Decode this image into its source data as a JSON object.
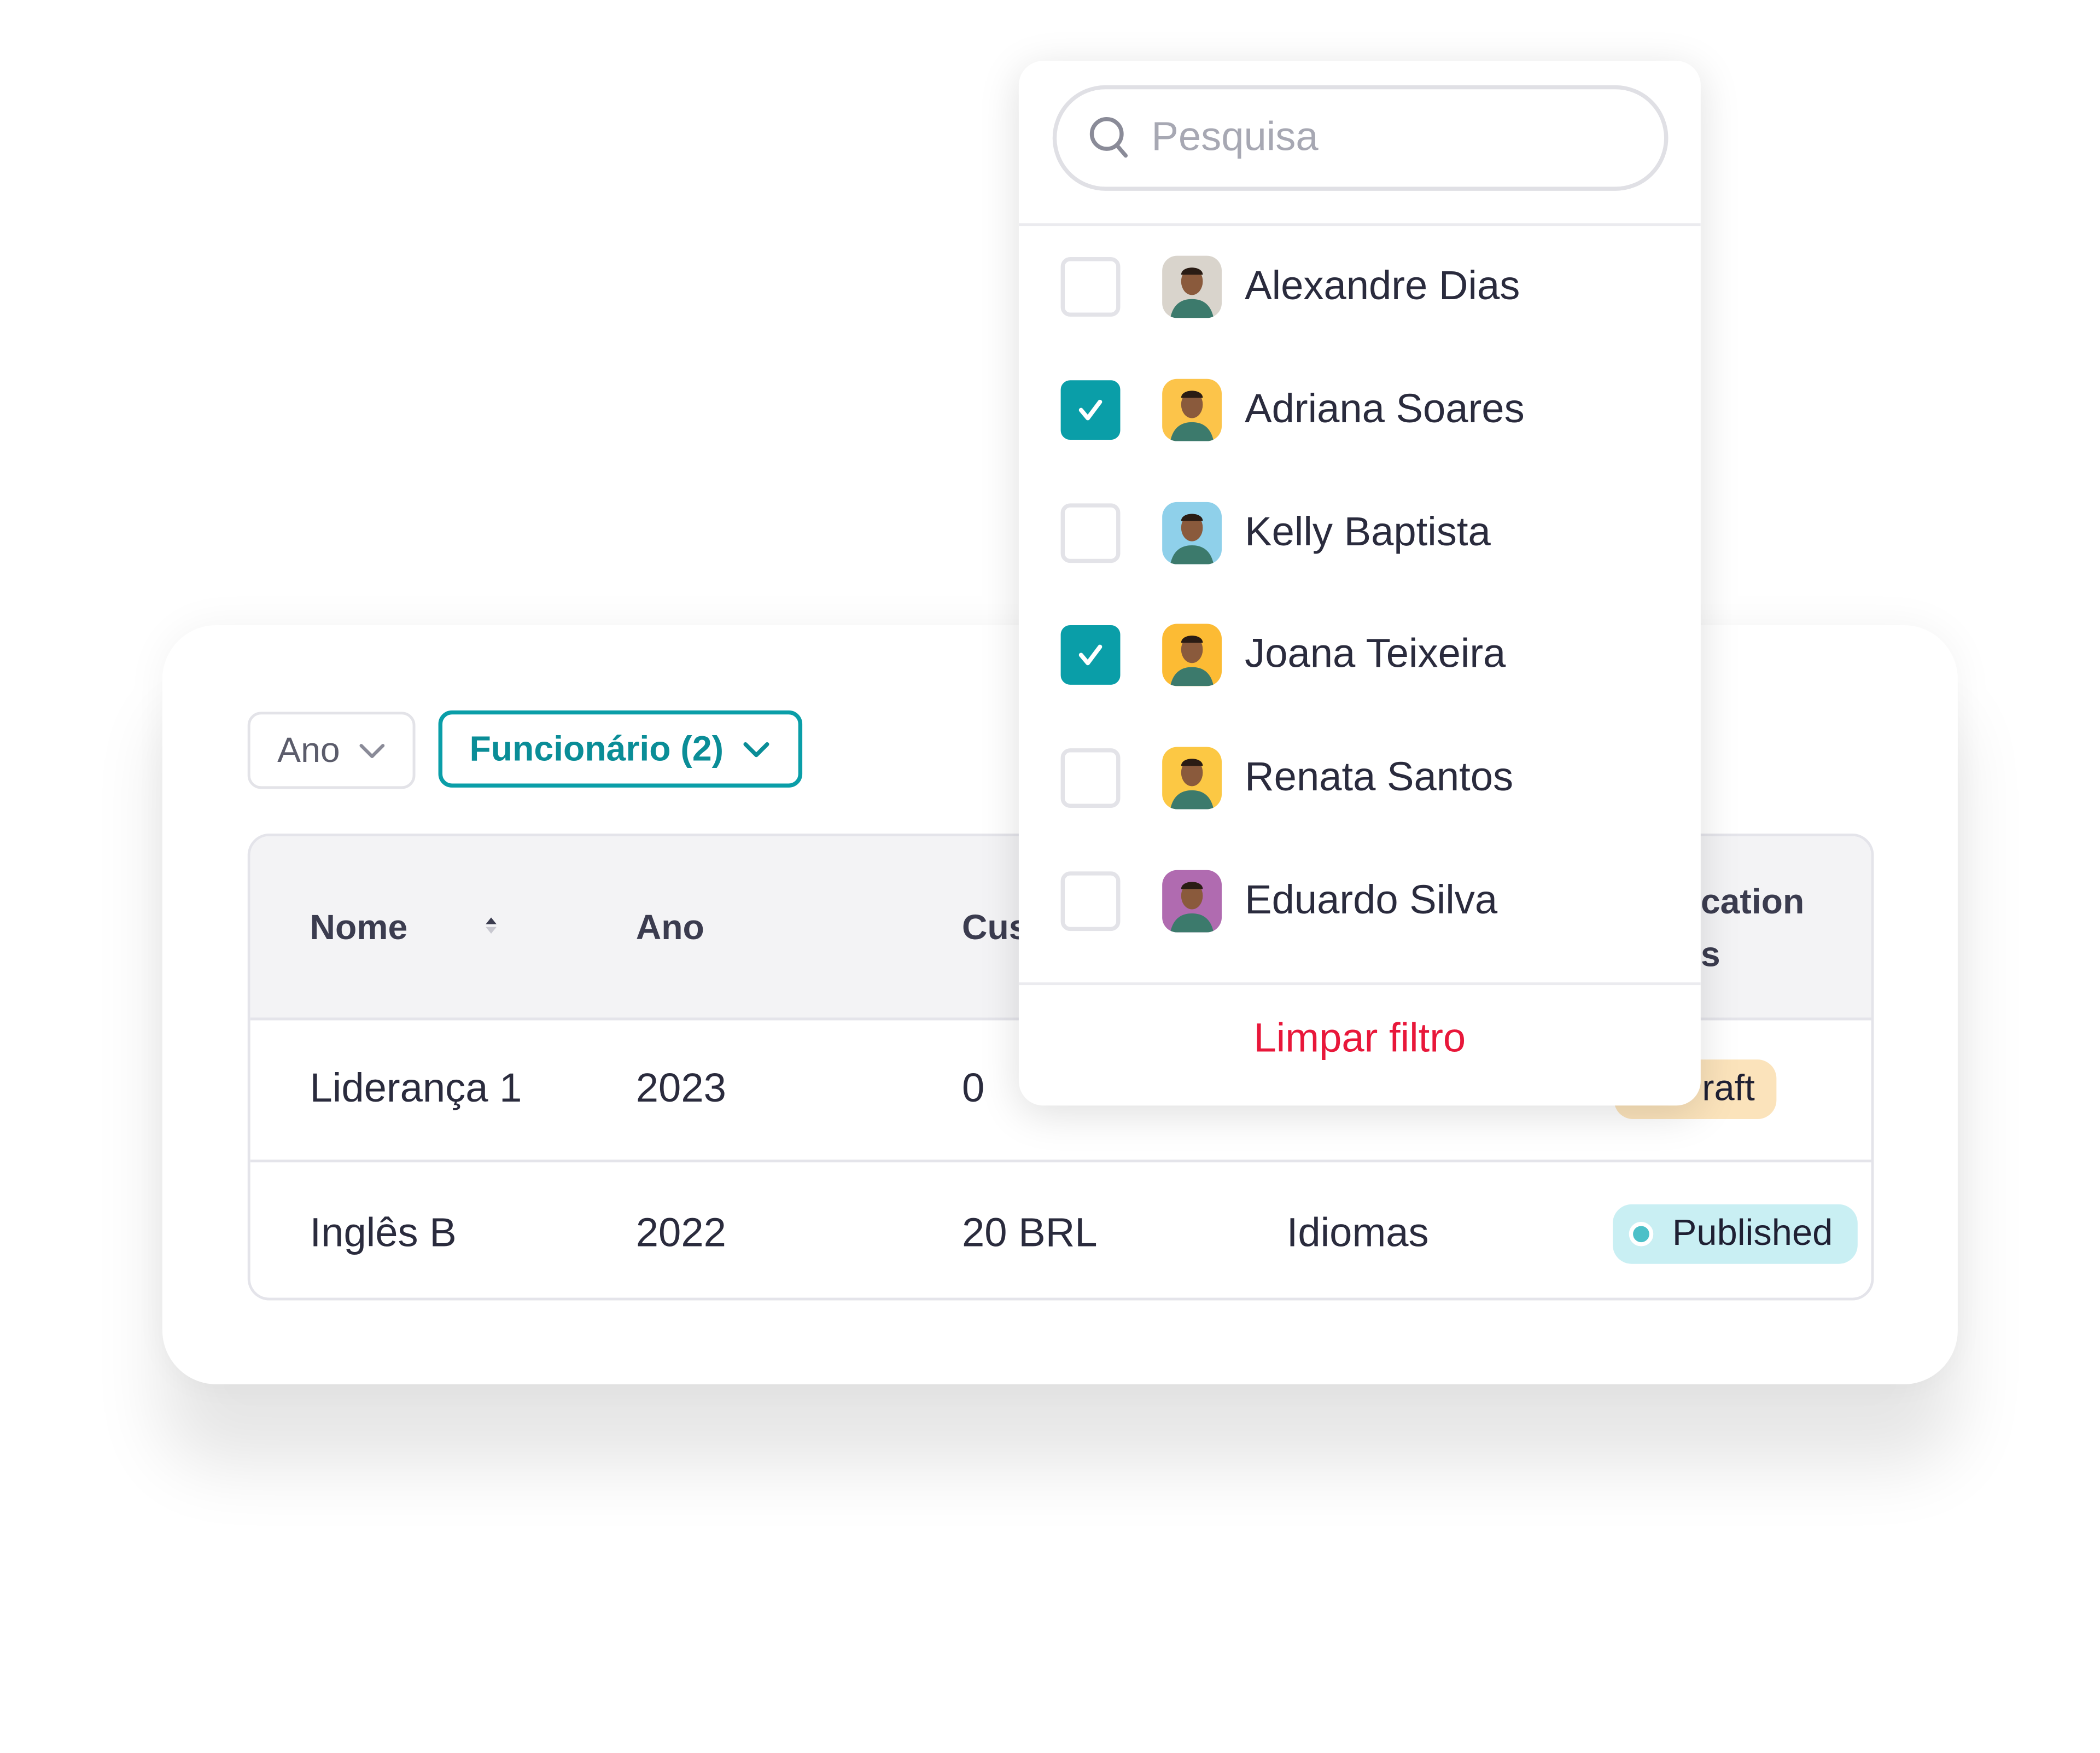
{
  "filters": {
    "year": {
      "label": "Ano"
    },
    "employee": {
      "label": "Funcionário (2)"
    }
  },
  "table": {
    "headers": {
      "name": "Nome",
      "year": "Ano",
      "cost": "Cus",
      "status_line1": "cation",
      "status_line2": "s"
    },
    "rows": [
      {
        "name": "Liderança 1",
        "year": "2023",
        "cost": "0",
        "category": "",
        "status": "raft",
        "status_color": "#fbe3bb"
      },
      {
        "name": "Inglês B",
        "year": "2022",
        "cost": "20 BRL",
        "category": "Idiomas",
        "status": "Published",
        "status_color": "#c9eff3"
      }
    ]
  },
  "dropdown": {
    "search_placeholder": "Pesquisa",
    "items": [
      {
        "name": "Alexandre Dias",
        "checked": false,
        "avatar_bg": "#d9d4cc"
      },
      {
        "name": "Adriana Soares",
        "checked": true,
        "avatar_bg": "#fcc44a"
      },
      {
        "name": "Kelly Baptista",
        "checked": false,
        "avatar_bg": "#8fd0ea"
      },
      {
        "name": "Joana Teixeira",
        "checked": true,
        "avatar_bg": "#fcbb34"
      },
      {
        "name": "Renata Santos",
        "checked": false,
        "avatar_bg": "#fcc844"
      },
      {
        "name": "Eduardo Silva",
        "checked": false,
        "avatar_bg": "#b06bb0"
      }
    ],
    "clear_label": "Limpar filtro"
  },
  "colors": {
    "accent": "#0a9ea8",
    "danger": "#e8173a"
  }
}
